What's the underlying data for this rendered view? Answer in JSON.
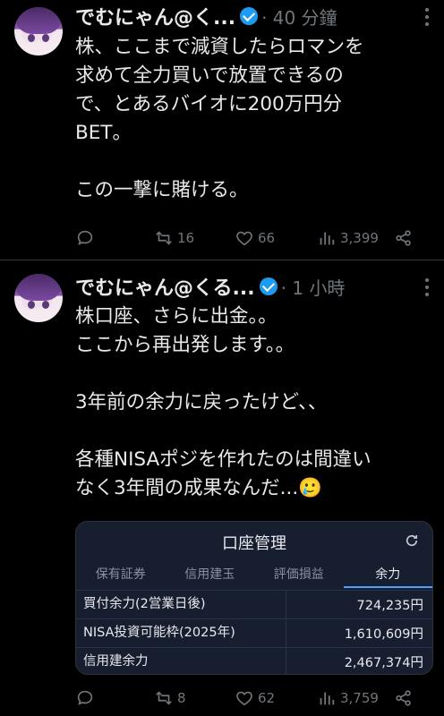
{
  "tweets": [
    {
      "author": "でむにゃん@く...",
      "time": "· 40 分鐘",
      "text": "株、ここまで減資したらロマンを\n求めて全力買いで放置できるの\nで、とあるバイオに200万円分\nBET。\n\nこの一撃に賭ける。",
      "reply_count": "",
      "retweet_count": "16",
      "like_count": "66",
      "view_count": "3,399"
    },
    {
      "author": "でむにゃん@くる...",
      "time": "· 1 小時",
      "text": "株口座、さらに出金。。\nここから再出発します。。\n\n3年前の余力に戻ったけど、、\n\n各種NISAポジを作れたのは間違い\nなく3年間の成果なんだ...🥲",
      "reply_count": "",
      "retweet_count": "8",
      "like_count": "62",
      "view_count": "3,759"
    }
  ],
  "card": {
    "title": "口座管理",
    "tabs": [
      "保有証券",
      "信用建玉",
      "評価損益",
      "余力"
    ],
    "active_tab": "余力",
    "rows": [
      {
        "label": "買付余力(2営業日後)",
        "value": "724,235円"
      },
      {
        "label": "NISA投資可能枠(2025年)",
        "value": "1,610,609円"
      },
      {
        "label": "信用建余力",
        "value": "2,467,374円"
      }
    ]
  },
  "icons": {
    "verified": "verified-badge-icon",
    "more": "more-options-icon",
    "reply": "reply-icon",
    "retweet": "retweet-icon",
    "like": "like-icon",
    "views": "views-icon",
    "share": "share-icon",
    "refresh": "refresh-icon"
  },
  "colors": {
    "background": "#000000",
    "text": "#e7e9ea",
    "muted": "#71767b",
    "verified": "#1d9bf0",
    "card_bg": "#171e30",
    "active_tab": "#4da3ff"
  }
}
